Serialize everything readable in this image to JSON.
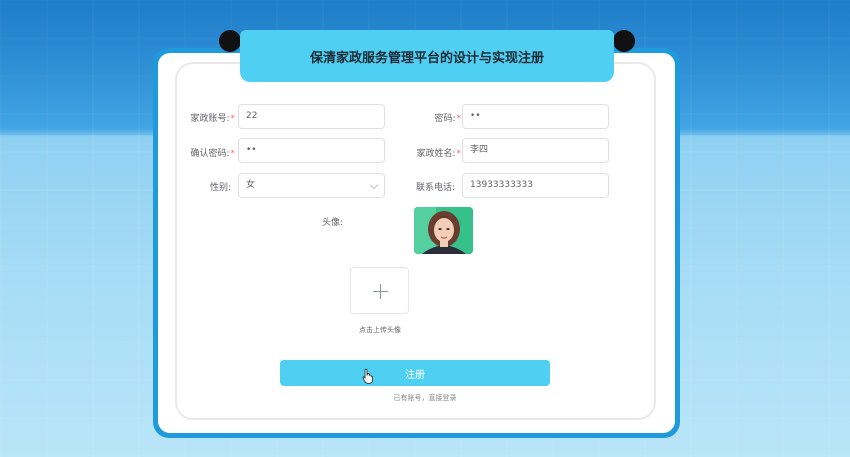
{
  "title": "保清家政服务管理平台的设计与实现注册",
  "form": {
    "account_label": "家政账号:",
    "account_value": "22",
    "password_label": "密码:",
    "password_value": "••",
    "confirm_label": "确认密码:",
    "confirm_value": "••",
    "name_label": "家政姓名:",
    "name_value": "李四",
    "gender_label": "性别:",
    "gender_value": "女",
    "phone_label": "联系电话:",
    "phone_value": "13933333333",
    "avatar_label": "头像:",
    "required_mark": "*"
  },
  "upload": {
    "text": "点击上传头像"
  },
  "register_button": "注册",
  "login_link": "已有账号，直接登录",
  "colors": {
    "accent": "#4fd0f3",
    "frame": "#1f9bdb",
    "required": "#f56c6c"
  }
}
